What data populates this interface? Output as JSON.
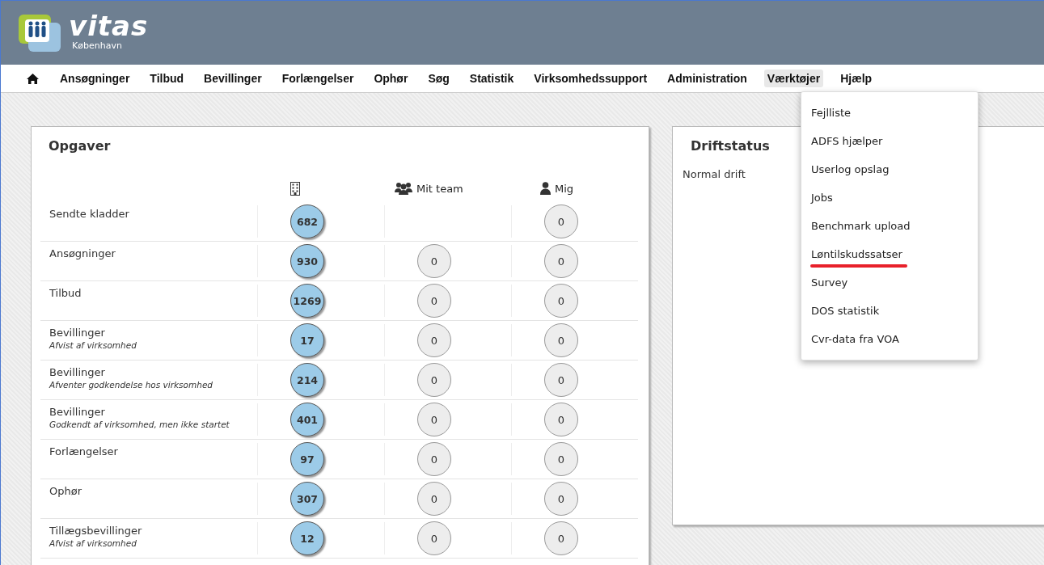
{
  "logo": {
    "name": "vitas",
    "subtitle": "København"
  },
  "nav": [
    {
      "label": "Ansøgninger",
      "selected": false
    },
    {
      "label": "Tilbud",
      "selected": false
    },
    {
      "label": "Bevillinger",
      "selected": false
    },
    {
      "label": "Forlængelser",
      "selected": false
    },
    {
      "label": "Ophør",
      "selected": false
    },
    {
      "label": "Søg",
      "selected": false
    },
    {
      "label": "Statistik",
      "selected": false
    },
    {
      "label": "Virksomhedssupport",
      "selected": false
    },
    {
      "label": "Administration",
      "selected": false
    },
    {
      "label": "Værktøjer",
      "selected": true
    },
    {
      "label": "Hjælp",
      "selected": false
    }
  ],
  "menu": [
    {
      "label": "Fejlliste",
      "marked": false
    },
    {
      "label": "ADFS hjælper",
      "marked": false
    },
    {
      "label": "Userlog opslag",
      "marked": false
    },
    {
      "label": "Jobs",
      "marked": false
    },
    {
      "label": "Benchmark upload",
      "marked": false
    },
    {
      "label": "Løntilskudssatser",
      "marked": true
    },
    {
      "label": "Survey",
      "marked": false
    },
    {
      "label": "DOS statistik",
      "marked": false
    },
    {
      "label": "Cvr-data fra VOA",
      "marked": false
    }
  ],
  "tasks": {
    "title": "Opgaver",
    "columns": [
      {
        "kind": "building"
      },
      {
        "kind": "team",
        "label": "Mit team"
      },
      {
        "kind": "person",
        "label": "Mig"
      }
    ],
    "rows": [
      {
        "label": "Sendte kladder",
        "all": "682",
        "me": "0"
      },
      {
        "label": "Ansøgninger",
        "all": "930",
        "team": "0",
        "me": "0"
      },
      {
        "label": "Tilbud",
        "all": "1269",
        "team": "0",
        "me": "0"
      },
      {
        "label": "Bevillinger",
        "note": "Afvist af virksomhed",
        "all": "17",
        "team": "0",
        "me": "0"
      },
      {
        "label": "Bevillinger",
        "note": "Afventer godkendelse hos virksomhed",
        "all": "214",
        "team": "0",
        "me": "0"
      },
      {
        "label": "Bevillinger",
        "note": "Godkendt af virksomhed, men ikke startet",
        "all": "401",
        "team": "0",
        "me": "0"
      },
      {
        "label": "Forlængelser",
        "all": "97",
        "team": "0",
        "me": "0"
      },
      {
        "label": "Ophør",
        "all": "307",
        "team": "0",
        "me": "0"
      },
      {
        "label": "Tillægsbevillinger",
        "note": "Afvist af virksomhed",
        "all": "12",
        "team": "0",
        "me": "0"
      }
    ]
  },
  "status": {
    "title": "Driftstatus",
    "text": "Normal drift"
  }
}
